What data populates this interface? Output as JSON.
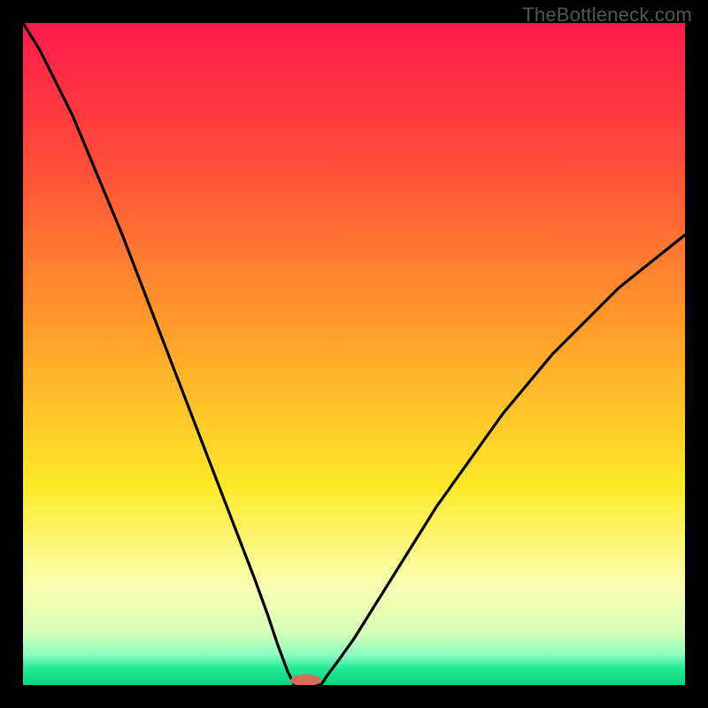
{
  "watermark": "TheBottleneck.com",
  "chart_data": {
    "type": "line",
    "title": "",
    "xlabel": "",
    "ylabel": "",
    "xlim": [
      0,
      100
    ],
    "ylim": [
      0,
      100
    ],
    "gradient_stops": [
      {
        "offset": 0,
        "color": "#ff1a4b"
      },
      {
        "offset": 0.2,
        "color": "#ff4a3a"
      },
      {
        "offset": 0.45,
        "color": "#ff9a2a"
      },
      {
        "offset": 0.7,
        "color": "#ffe92a"
      },
      {
        "offset": 0.85,
        "color": "#f8ffb0"
      },
      {
        "offset": 0.92,
        "color": "#d8ffb8"
      },
      {
        "offset": 0.955,
        "color": "#8afcc0"
      },
      {
        "offset": 0.975,
        "color": "#22e892"
      },
      {
        "offset": 1.0,
        "color": "#0dd680"
      }
    ],
    "series": [
      {
        "name": "bottleneck-curve",
        "x": [
          0.0,
          2.5,
          5.0,
          7.5,
          10.0,
          12.5,
          15.0,
          17.5,
          20.0,
          22.5,
          25.0,
          27.5,
          30.0,
          32.5,
          35.0,
          37.0,
          38.5,
          40.0,
          41.0,
          42.0,
          43.0,
          44.0,
          45.0,
          46.0,
          47.5,
          50.0,
          52.5,
          55.0,
          57.5,
          60.0,
          62.5,
          65.0,
          67.5,
          70.0,
          72.5,
          75.0,
          77.5,
          80.0,
          82.5,
          85.0,
          87.5,
          90.0,
          92.5,
          95.0,
          97.5,
          100.0
        ],
        "y": [
          100.0,
          96.0,
          91.0,
          86.0,
          80.0,
          74.0,
          68.0,
          61.5,
          55.0,
          48.5,
          42.0,
          35.5,
          29.0,
          22.5,
          16.0,
          10.5,
          6.0,
          2.0,
          0.0,
          0.0,
          0.0,
          0.0,
          0.0,
          1.5,
          3.5,
          7.0,
          11.0,
          15.0,
          19.0,
          23.0,
          27.0,
          30.5,
          34.0,
          37.5,
          41.0,
          44.0,
          47.0,
          50.0,
          52.5,
          55.0,
          57.5,
          60.0,
          62.0,
          64.0,
          66.0,
          68.0
        ]
      }
    ],
    "marker": {
      "name": "optimum-marker",
      "x": 42.7,
      "y": 0.7,
      "rx": 2.3,
      "ry": 0.9,
      "color": "#d96b5a"
    }
  }
}
